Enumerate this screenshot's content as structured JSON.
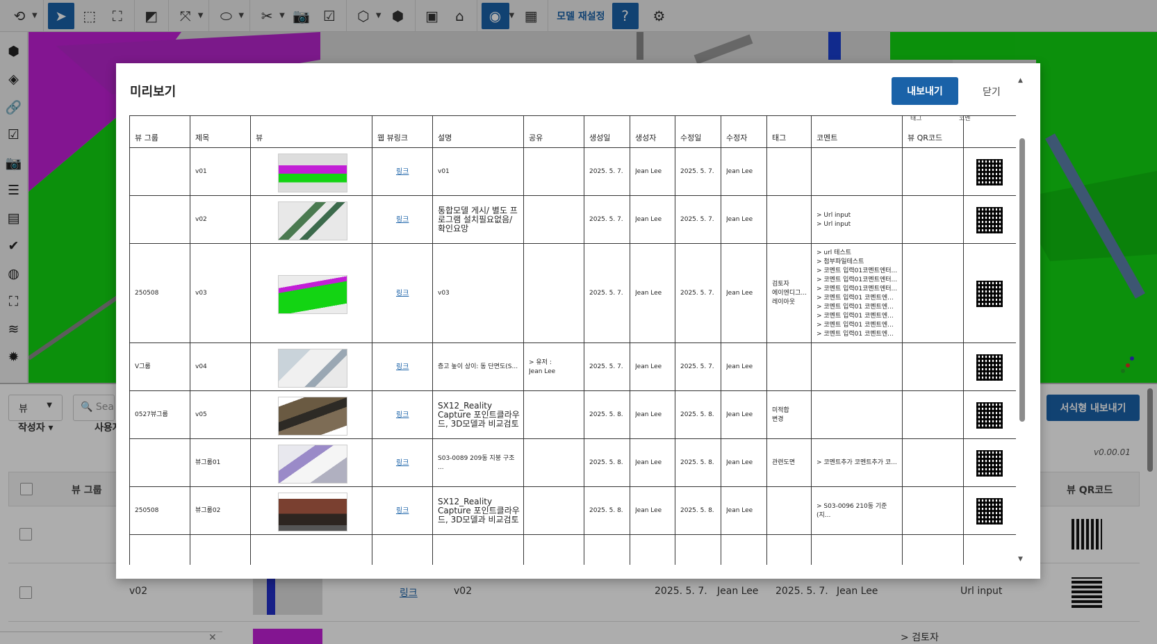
{
  "toolbar": {
    "reset_model_label": "모델 재설정"
  },
  "background": {
    "view_select": "뷰",
    "search_placeholder": "Search",
    "export_formatted": "서식형 내보내기",
    "filter_author": "작성자",
    "filter_user": "사용자",
    "version": "v0.00.01",
    "col_view_group": "뷰 그룹",
    "col_qr": "뷰 QR코드",
    "rows": [
      {
        "title": "v02",
        "link": "링크",
        "desc": "v02",
        "created": "2025. 5. 7.",
        "creator": "Jean Lee",
        "modified": "2025. 5. 7.",
        "modifier": "Jean Lee",
        "comment": "Url input"
      },
      {
        "comment": "> 검토자"
      }
    ]
  },
  "modal": {
    "title": "미리보기",
    "export_button": "내보내기",
    "close_button": "닫기",
    "cut_tag_header": "태그",
    "cut_comment_header": "코멘",
    "headers": [
      "뷰 그룹",
      "제목",
      "뷰",
      "웹 뷰링크",
      "설명",
      "공유",
      "생성일",
      "생성자",
      "수정일",
      "수정자",
      "태그",
      "코멘트",
      "뷰 QR코드"
    ],
    "rows": [
      {
        "group": "",
        "title": "v01",
        "link": "링크",
        "desc": "v01",
        "share": "",
        "created": "2025. 5. 7.",
        "creator": "Jean Lee",
        "modified": "2025. 5. 7.",
        "modifier": "Jean Lee",
        "tags": "",
        "comments": ""
      },
      {
        "group": "",
        "title": "v02",
        "link": "링크",
        "desc": "통합모델 게시/ 별도 프로그램 설치필요없음/ 확인요망",
        "share": "",
        "created": "2025. 5. 7.",
        "creator": "Jean Lee",
        "modified": "2025. 5. 7.",
        "modifier": "Jean Lee",
        "tags": "",
        "comments": "> Url input\n> Url input"
      },
      {
        "group": "250508",
        "title": "v03",
        "link": "링크",
        "desc": "v03",
        "share": "",
        "created": "2025. 5. 7.",
        "creator": "Jean Lee",
        "modified": "2025. 5. 7.",
        "modifier": "Jean Lee",
        "tags": "검토자\n에이엔디그...\n레이아웃",
        "comments": "> url 테스트\n> 첨부파일테스트\n> 코멘트 입력01코멘트엔터...\n> 코멘트 입력01코멘트엔터...\n> 코멘트 입력01코멘트엔터...\n> 코멘트 입력01 코멘트엔...\n> 코멘트 입력01 코멘트엔...\n> 코멘트 입력01 코멘트엔...\n> 코멘트 입력01 코멘트엔...\n> 코멘트 입력01 코멘트엔..."
      },
      {
        "group": "V그룹",
        "title": "v04",
        "link": "링크",
        "desc": "층고 높이 상이: 동 단면도(S...",
        "share": "> 유저 :\nJean Lee",
        "created": "2025. 5. 7.",
        "creator": "Jean Lee",
        "modified": "2025. 5. 7.",
        "modifier": "Jean Lee",
        "tags": "",
        "comments": ""
      },
      {
        "group": "0527뷰그룹",
        "title": "v05",
        "link": "링크",
        "desc": "SX12_Reality Capture 포인트클라우드, 3D모델과 비교검토",
        "share": "",
        "created": "2025. 5. 8.",
        "creator": "Jean Lee",
        "modified": "2025. 5. 8.",
        "modifier": "Jean Lee",
        "tags": "미적합\n변경",
        "comments": ""
      },
      {
        "group": "",
        "title": "뷰그룹01",
        "link": "링크",
        "desc": "S03-0089 209동 지붕 구조 ...",
        "share": "",
        "created": "2025. 5. 8.",
        "creator": "Jean Lee",
        "modified": "2025. 5. 8.",
        "modifier": "Jean Lee",
        "tags": "관련도면",
        "comments": "> 코멘트추가 코멘트추가 코..."
      },
      {
        "group": "250508",
        "title": "뷰그룹02",
        "link": "링크",
        "desc": "SX12_Reality Capture 포인트클라우드, 3D모델과 비교검토",
        "share": "",
        "created": "2025. 5. 8.",
        "creator": "Jean Lee",
        "modified": "2025. 5. 8.",
        "modifier": "Jean Lee",
        "tags": "",
        "comments": "> S03-0096 210동 기준(지..."
      }
    ]
  },
  "colors": {
    "primary": "#1a62a8",
    "viewport_green": "#14d614",
    "viewport_magenta": "#c21fd6"
  }
}
